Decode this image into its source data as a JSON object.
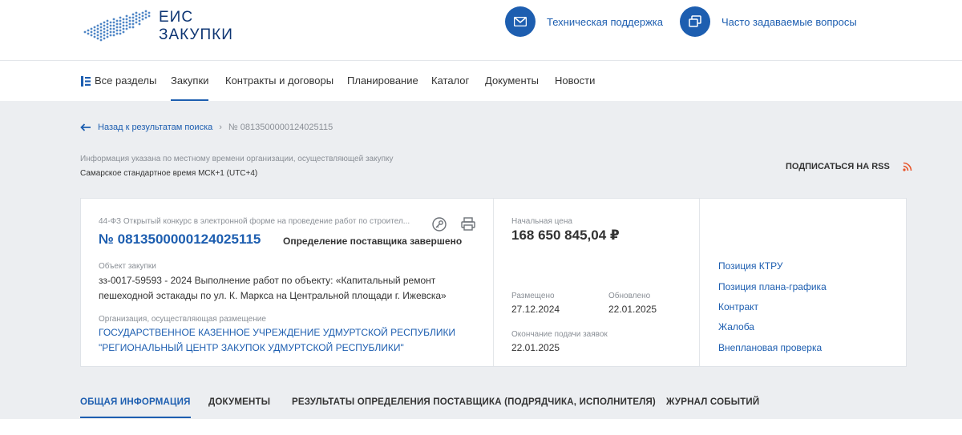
{
  "header": {
    "logo_line1": "ЕИС",
    "logo_line2": "ЗАКУПКИ",
    "support_label": "Техническая поддержка",
    "faq_label": "Часто задаваемые вопросы"
  },
  "nav": {
    "all_sections": "Все разделы",
    "items": [
      "Закупки",
      "Контракты и договоры",
      "Планирование",
      "Каталог",
      "Документы",
      "Новости"
    ],
    "active": "Закупки"
  },
  "breadcrumb": {
    "back_label": "Назад к результатам поиска",
    "separator": "›",
    "current": "№ 0813500000124025115"
  },
  "notice": {
    "timezone_info": "Информация указана по местному времени организации, осуществляющей закупку",
    "timezone_value": "Самарское стандартное время МСК+1 (UTC+4)",
    "rss_label": "ПОДПИСАТЬСЯ НА RSS"
  },
  "card": {
    "procurement_type": "44-ФЗ Открытый конкурс в электронной форме на проведение работ по строител...",
    "reg_number": "№ 0813500000124025115",
    "status": "Определение поставщика завершено",
    "object_label": "Объект закупки",
    "object_text": "зз-0017-59593 - 2024 Выполнение работ по объекту: «Капитальный ремонт пешеходной эстакады по ул. К. Маркса на Центральной площади г. Ижевска»",
    "org_label": "Организация, осуществляющая размещение",
    "org_text": "ГОСУДАРСТВЕННОЕ КАЗЕННОЕ УЧРЕЖДЕНИЕ УДМУРТСКОЙ РЕСПУБЛИКИ \"РЕГИОНАЛЬНЫЙ ЦЕНТР ЗАКУПОК УДМУРТСКОЙ РЕСПУБЛИКИ\"",
    "price_label": "Начальная цена",
    "price_value": "168 650 845,04 ₽",
    "posted_label": "Размещено",
    "posted_value": "27.12.2024",
    "updated_label": "Обновлено",
    "updated_value": "22.01.2025",
    "deadline_label": "Окончание подачи заявок",
    "deadline_value": "22.01.2025",
    "links": [
      "Позиция КТРУ",
      "Позиция плана-графика",
      "Контракт",
      "Жалоба",
      "Внеплановая проверка"
    ]
  },
  "tabs": {
    "items": [
      "ОБЩАЯ ИНФОРМАЦИЯ",
      "ДОКУМЕНТЫ",
      "РЕЗУЛЬТАТЫ ОПРЕДЕЛЕНИЯ ПОСТАВЩИКА (ПОДРЯДЧИКА, ИСПОЛНИТЕЛЯ)",
      "ЖУРНАЛ СОБЫТИЙ"
    ],
    "active": "ОБЩАЯ ИНФОРМАЦИЯ"
  },
  "colors": {
    "accent": "#1d5eb0",
    "logo_dark": "#0d3573",
    "muted": "#8a8f96",
    "rss": "#e8552b",
    "page_bg": "#eceef1"
  }
}
